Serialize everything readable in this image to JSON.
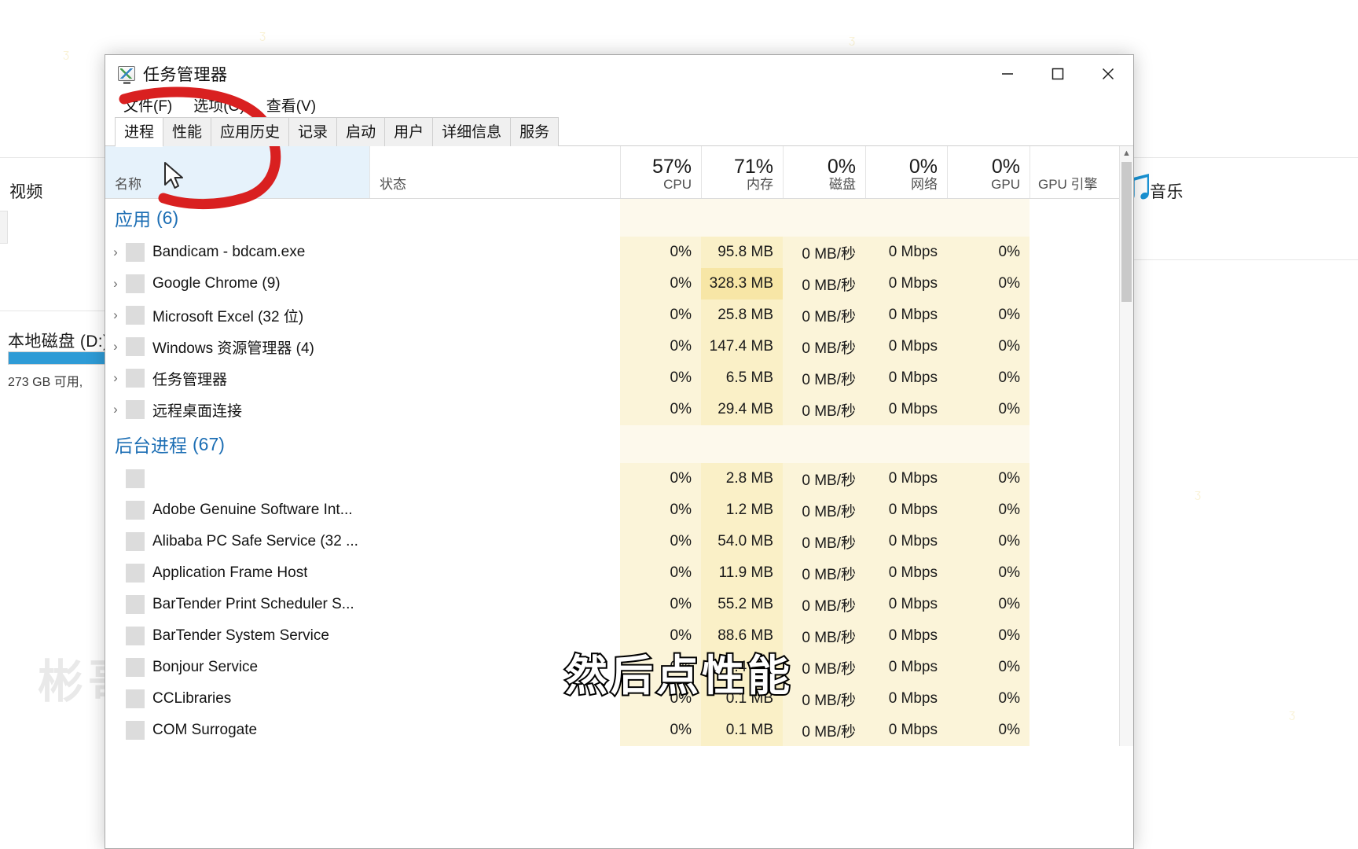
{
  "desktop": {
    "left_panel": {
      "video_label": "视频",
      "disk_label": "本地磁盘 (D:)",
      "disk_free": "273 GB 可用,"
    },
    "right_panel": {
      "music_label": "音乐",
      "music_icon": "music-note-icon"
    },
    "watermark": "彬哥"
  },
  "window": {
    "title": "任务管理器",
    "icon": "task-manager-icon",
    "controls": {
      "minimize": "minimize-icon",
      "maximize": "maximize-icon",
      "close": "close-icon"
    },
    "menu": [
      {
        "label": "文件(F)"
      },
      {
        "label": "选项(O)"
      },
      {
        "label": "查看(V)"
      }
    ],
    "tabs": [
      {
        "label": "进程",
        "active": true
      },
      {
        "label": "性能",
        "active": false
      },
      {
        "label": "应用历史",
        "active": false
      },
      {
        "label": "记录",
        "active": false
      },
      {
        "label": "启动",
        "active": false
      },
      {
        "label": "用户",
        "active": false
      },
      {
        "label": "详细信息",
        "active": false
      },
      {
        "label": "服务",
        "active": false
      }
    ]
  },
  "table": {
    "columns": [
      {
        "key": "name",
        "label": "名称",
        "pct": ""
      },
      {
        "key": "status",
        "label": "状态",
        "pct": ""
      },
      {
        "key": "cpu",
        "label": "CPU",
        "pct": "57%"
      },
      {
        "key": "memory",
        "label": "内存",
        "pct": "71%"
      },
      {
        "key": "disk",
        "label": "磁盘",
        "pct": "0%"
      },
      {
        "key": "network",
        "label": "网络",
        "pct": "0%"
      },
      {
        "key": "gpu",
        "label": "GPU",
        "pct": "0%"
      },
      {
        "key": "gpueng",
        "label": "GPU 引擎",
        "pct": ""
      }
    ],
    "groups": [
      {
        "label": "应用",
        "count": "(6)",
        "rows": [
          {
            "name": "Bandicam - bdcam.exe",
            "expandable": true,
            "cpu": "0%",
            "memory": "95.8 MB",
            "disk": "0 MB/秒",
            "network": "0 Mbps",
            "gpu": "0%"
          },
          {
            "name": "Google Chrome (9)",
            "expandable": true,
            "cpu": "0%",
            "memory": "328.3 MB",
            "disk": "0 MB/秒",
            "network": "0 Mbps",
            "gpu": "0%"
          },
          {
            "name": "Microsoft Excel (32 位)",
            "expandable": true,
            "cpu": "0%",
            "memory": "25.8 MB",
            "disk": "0 MB/秒",
            "network": "0 Mbps",
            "gpu": "0%"
          },
          {
            "name": "Windows 资源管理器 (4)",
            "expandable": true,
            "cpu": "0%",
            "memory": "147.4 MB",
            "disk": "0 MB/秒",
            "network": "0 Mbps",
            "gpu": "0%"
          },
          {
            "name": "任务管理器",
            "expandable": true,
            "cpu": "0%",
            "memory": "6.5 MB",
            "disk": "0 MB/秒",
            "network": "0 Mbps",
            "gpu": "0%"
          },
          {
            "name": "远程桌面连接",
            "expandable": true,
            "cpu": "0%",
            "memory": "29.4 MB",
            "disk": "0 MB/秒",
            "network": "0 Mbps",
            "gpu": "0%"
          }
        ]
      },
      {
        "label": "后台进程",
        "count": "(67)",
        "rows": [
          {
            "name": "",
            "expandable": false,
            "cpu": "0%",
            "memory": "2.8 MB",
            "disk": "0 MB/秒",
            "network": "0 Mbps",
            "gpu": "0%"
          },
          {
            "name": "Adobe Genuine Software Int...",
            "expandable": false,
            "cpu": "0%",
            "memory": "1.2 MB",
            "disk": "0 MB/秒",
            "network": "0 Mbps",
            "gpu": "0%"
          },
          {
            "name": "Alibaba PC Safe Service (32 ...",
            "expandable": false,
            "cpu": "0%",
            "memory": "54.0 MB",
            "disk": "0 MB/秒",
            "network": "0 Mbps",
            "gpu": "0%"
          },
          {
            "name": "Application Frame Host",
            "expandable": false,
            "cpu": "0%",
            "memory": "11.9 MB",
            "disk": "0 MB/秒",
            "network": "0 Mbps",
            "gpu": "0%"
          },
          {
            "name": "BarTender Print Scheduler S...",
            "expandable": false,
            "cpu": "0%",
            "memory": "55.2 MB",
            "disk": "0 MB/秒",
            "network": "0 Mbps",
            "gpu": "0%"
          },
          {
            "name": "BarTender System Service",
            "expandable": false,
            "cpu": "0%",
            "memory": "88.6 MB",
            "disk": "0 MB/秒",
            "network": "0 Mbps",
            "gpu": "0%"
          },
          {
            "name": "Bonjour Service",
            "expandable": false,
            "cpu": "0%",
            "memory": "1.4 MB",
            "disk": "0 MB/秒",
            "network": "0 Mbps",
            "gpu": "0%"
          },
          {
            "name": "CCLibraries",
            "expandable": false,
            "cpu": "0%",
            "memory": "0.1 MB",
            "disk": "0 MB/秒",
            "network": "0 Mbps",
            "gpu": "0%"
          },
          {
            "name": "COM Surrogate",
            "expandable": false,
            "cpu": "0%",
            "memory": "0.1 MB",
            "disk": "0 MB/秒",
            "network": "0 Mbps",
            "gpu": "0%"
          }
        ]
      }
    ]
  },
  "annotation": {
    "subtitle": "然后点性能",
    "highlight_color": "#d92020",
    "shape": "red-circle-annotation"
  }
}
